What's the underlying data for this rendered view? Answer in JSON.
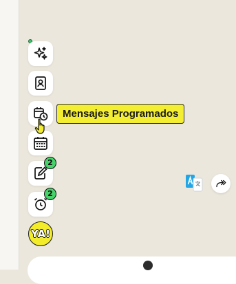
{
  "sidebar": {
    "items": [
      {
        "name": "sparkles",
        "icon": "sparkles-icon"
      },
      {
        "name": "contacts",
        "icon": "contact-book-icon"
      },
      {
        "name": "scheduled-messages",
        "icon": "calendar-clock-icon"
      },
      {
        "name": "calendar",
        "icon": "calendar-icon"
      },
      {
        "name": "tasks",
        "icon": "edit-note-icon",
        "badge": "2"
      },
      {
        "name": "reminders",
        "icon": "alarm-clock-icon",
        "badge": "2"
      },
      {
        "name": "brand",
        "label": "YA!"
      }
    ]
  },
  "tooltip": {
    "text": "Mensajes Programados"
  },
  "colors": {
    "accent_yellow": "#f4ee33",
    "badge_green": "#46d36a",
    "background": "#ebe7dd"
  }
}
